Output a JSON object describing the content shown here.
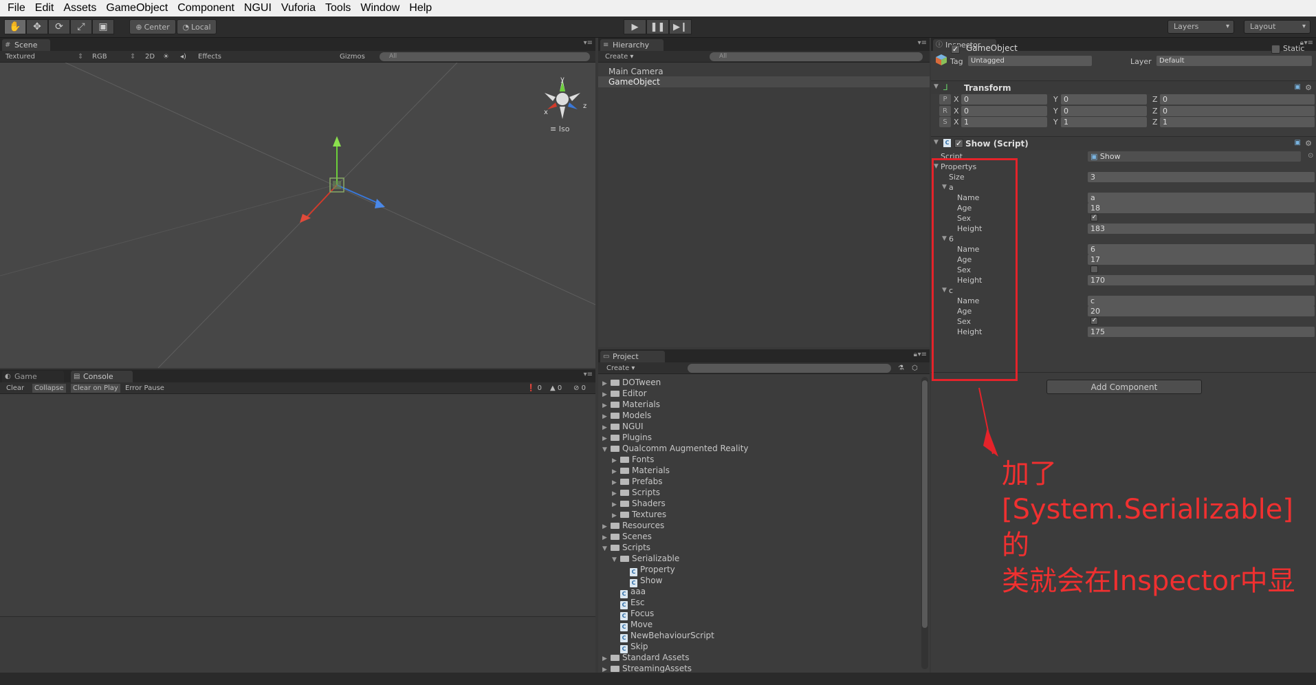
{
  "menubar": [
    "File",
    "Edit",
    "Assets",
    "GameObject",
    "Component",
    "NGUI",
    "Vuforia",
    "Tools",
    "Window",
    "Help"
  ],
  "toolbar": {
    "tools": [
      "hand-tool",
      "move-tool",
      "rotate-tool",
      "scale-tool",
      "rect-tool"
    ],
    "pivot": "Center",
    "space": "Local",
    "layers": "Layers",
    "layout": "Layout"
  },
  "scene": {
    "tab": "Scene",
    "shading": "Textured",
    "render_mode": "RGB",
    "mode_2d": "2D",
    "effects": "Effects",
    "gizmos": "Gizmos",
    "search": "All",
    "projection": "Iso",
    "axis_x": "x",
    "axis_y": "y",
    "axis_z": "z"
  },
  "hierarchy": {
    "tab": "Hierarchy",
    "create": "Create",
    "search": "All",
    "items": [
      "Main Camera",
      "GameObject"
    ]
  },
  "console": {
    "tab_game": "Game",
    "tab_console": "Console",
    "buttons": [
      "Clear",
      "Collapse",
      "Clear on Play",
      "Error Pause"
    ],
    "counts": [
      "0",
      "0",
      "0"
    ]
  },
  "project": {
    "tab": "Project",
    "create": "Create",
    "tree": [
      {
        "label": "DOTween",
        "level": 0,
        "type": "folder",
        "arrow": "▶"
      },
      {
        "label": "Editor",
        "level": 0,
        "type": "folder",
        "arrow": "▶"
      },
      {
        "label": "Materials",
        "level": 0,
        "type": "folder",
        "arrow": "▶"
      },
      {
        "label": "Models",
        "level": 0,
        "type": "folder",
        "arrow": "▶"
      },
      {
        "label": "NGUI",
        "level": 0,
        "type": "folder",
        "arrow": "▶"
      },
      {
        "label": "Plugins",
        "level": 0,
        "type": "folder",
        "arrow": "▶"
      },
      {
        "label": "Qualcomm Augmented Reality",
        "level": 0,
        "type": "folder",
        "arrow": "▼"
      },
      {
        "label": "Fonts",
        "level": 1,
        "type": "folder",
        "arrow": "▶"
      },
      {
        "label": "Materials",
        "level": 1,
        "type": "folder",
        "arrow": "▶"
      },
      {
        "label": "Prefabs",
        "level": 1,
        "type": "folder",
        "arrow": "▶"
      },
      {
        "label": "Scripts",
        "level": 1,
        "type": "folder",
        "arrow": "▶"
      },
      {
        "label": "Shaders",
        "level": 1,
        "type": "folder",
        "arrow": "▶"
      },
      {
        "label": "Textures",
        "level": 1,
        "type": "folder",
        "arrow": "▶"
      },
      {
        "label": "Resources",
        "level": 0,
        "type": "folder",
        "arrow": "▶"
      },
      {
        "label": "Scenes",
        "level": 0,
        "type": "folder",
        "arrow": "▶"
      },
      {
        "label": "Scripts",
        "level": 0,
        "type": "folder",
        "arrow": "▼"
      },
      {
        "label": "Serializable",
        "level": 1,
        "type": "folder",
        "arrow": "▼"
      },
      {
        "label": "Property",
        "level": 2,
        "type": "script",
        "arrow": ""
      },
      {
        "label": "Show",
        "level": 2,
        "type": "script",
        "arrow": ""
      },
      {
        "label": "aaa",
        "level": 1,
        "type": "script",
        "arrow": ""
      },
      {
        "label": "Esc",
        "level": 1,
        "type": "script",
        "arrow": ""
      },
      {
        "label": "Focus",
        "level": 1,
        "type": "script",
        "arrow": ""
      },
      {
        "label": "Move",
        "level": 1,
        "type": "script",
        "arrow": ""
      },
      {
        "label": "NewBehaviourScript",
        "level": 1,
        "type": "script",
        "arrow": ""
      },
      {
        "label": "Skip",
        "level": 1,
        "type": "script",
        "arrow": ""
      },
      {
        "label": "Standard Assets",
        "level": 0,
        "type": "folder",
        "arrow": "▶"
      },
      {
        "label": "StreamingAssets",
        "level": 0,
        "type": "folder",
        "arrow": "▶"
      }
    ]
  },
  "inspector": {
    "tab": "Inspector",
    "object_name": "GameObject",
    "static": "Static",
    "tag_label": "Tag",
    "tag_value": "Untagged",
    "layer_label": "Layer",
    "layer_value": "Default",
    "transform": {
      "title": "Transform",
      "rows": [
        {
          "tag": "P",
          "x": "0",
          "y": "0",
          "z": "0"
        },
        {
          "tag": "R",
          "x": "0",
          "y": "0",
          "z": "0"
        },
        {
          "tag": "S",
          "x": "1",
          "y": "1",
          "z": "1"
        }
      ],
      "axis_x": "X",
      "axis_y": "Y",
      "axis_z": "Z"
    },
    "script_comp": {
      "title": "Show (Script)",
      "script_label": "Script",
      "script_value": "Show",
      "propertys_label": "Propertys",
      "size_label": "Size",
      "size_value": "3",
      "elements": [
        {
          "header": "a",
          "name": "a",
          "age": "18",
          "sex": true,
          "height": "183"
        },
        {
          "header": "6",
          "name": "6",
          "age": "17",
          "sex": false,
          "height": "170"
        },
        {
          "header": "c",
          "name": "c",
          "age": "20",
          "sex": true,
          "height": "175"
        }
      ],
      "field_labels": {
        "name": "Name",
        "age": "Age",
        "sex": "Sex",
        "height": "Height"
      }
    },
    "add_component": "Add Component"
  },
  "annotation": {
    "line1": "加了",
    "line2": "[System.Serializable]的",
    "line3": "类就会在Inspector中显"
  },
  "colors": {
    "annotation_red": "#e5232a",
    "bg_panel": "#3c3c3c",
    "scene_bg": "#474747"
  }
}
